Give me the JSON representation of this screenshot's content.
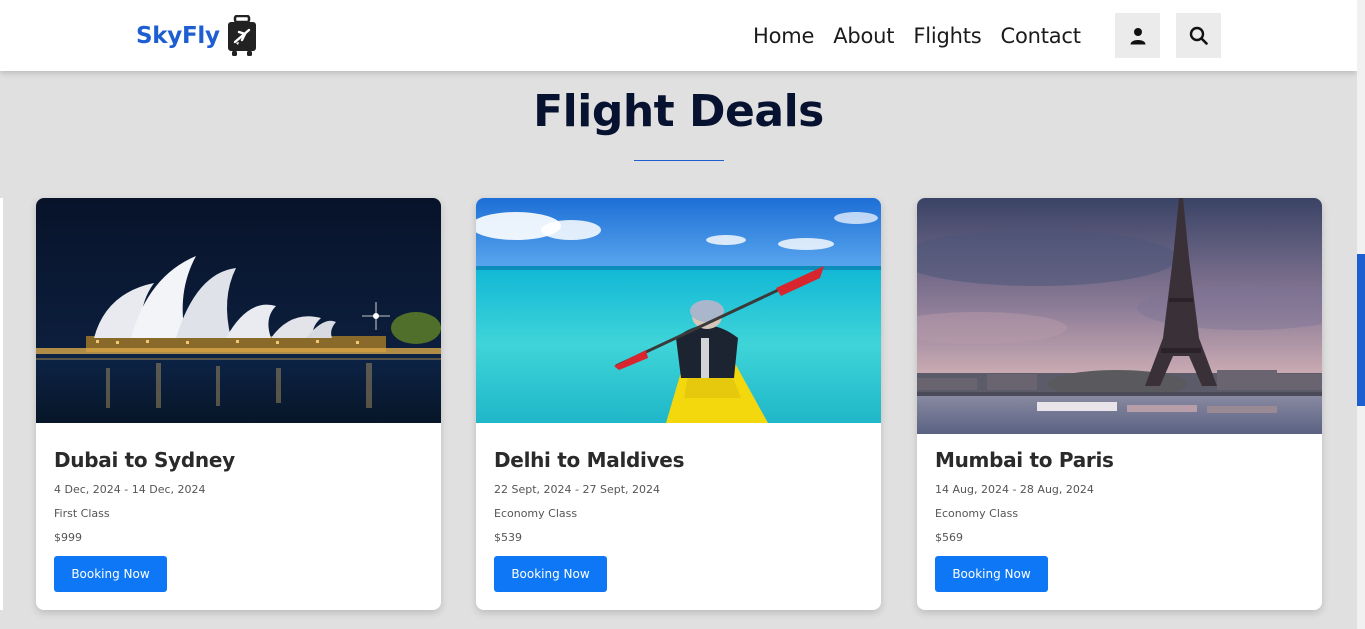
{
  "header": {
    "logo_text": "SkyFly",
    "logo_icon": "suitcase-plane-icon",
    "nav": [
      "Home",
      "About",
      "Flights",
      "Contact"
    ],
    "user_icon": "user-icon",
    "search_icon": "search-icon"
  },
  "colors": {
    "brand_blue": "#1d5fd1",
    "button_blue": "#0d77f5",
    "page_bg": "#e0e0e0",
    "title_color": "#071230"
  },
  "section": {
    "title": "Flight Deals"
  },
  "deals": [
    {
      "title": "Dubai to Sydney",
      "dates": "4 Dec, 2024 - 14 Dec, 2024",
      "class": "First Class",
      "price": "$999",
      "button": "Booking Now",
      "image": "sydney-opera-house-night-photo"
    },
    {
      "title": "Delhi to Maldives",
      "dates": "22 Sept, 2024 - 27 Sept, 2024",
      "class": "Economy Class",
      "price": "$539",
      "button": "Booking Now",
      "image": "kayaker-turquoise-sea-photo"
    },
    {
      "title": "Mumbai to Paris",
      "dates": "14 Aug, 2024 - 28 Aug, 2024",
      "class": "Economy Class",
      "price": "$569",
      "button": "Booking Now",
      "image": "eiffel-tower-sunset-photo"
    }
  ]
}
